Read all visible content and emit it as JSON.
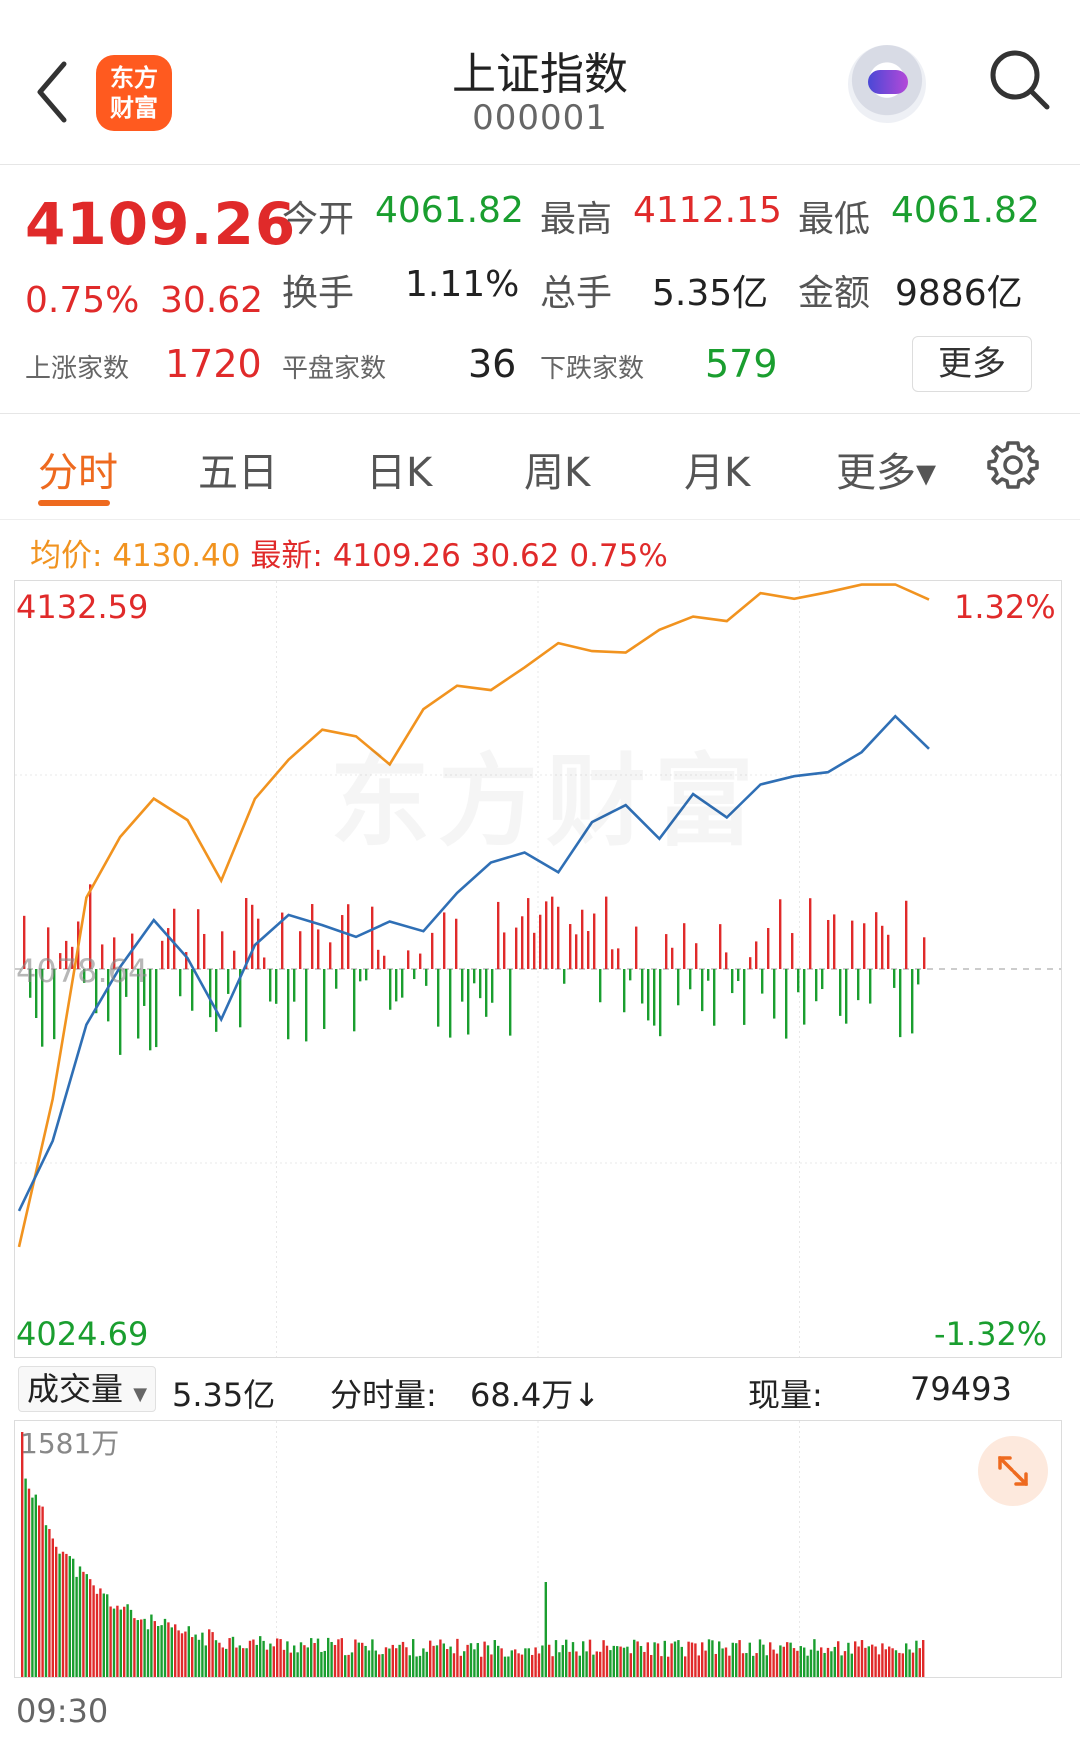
{
  "header": {
    "title": "上证指数",
    "code": "000001",
    "logo_text_line1": "东方",
    "logo_text_line2": "财富"
  },
  "quote": {
    "price": "4109.26",
    "change_pct": "0.75%",
    "change": "30.62",
    "open_label": "今开",
    "open": "4061.82",
    "high_label": "最高",
    "high": "4112.15",
    "low_label": "最低",
    "low": "4061.82",
    "turnover_label": "换手",
    "turnover": "1.11%",
    "volume_label": "总手",
    "volume": "5.35亿",
    "amount_label": "金额",
    "amount": "9886亿",
    "up_label": "上涨家数",
    "up_count": "1720",
    "flat_label": "平盘家数",
    "flat_count": "36",
    "down_label": "下跌家数",
    "down_count": "579",
    "more_label": "更多"
  },
  "tabs": [
    "分时",
    "五日",
    "日K",
    "周K",
    "月K",
    "更多▾"
  ],
  "info": {
    "avg_label": "均价:",
    "avg_value": "4130.40",
    "latest_label": "最新:",
    "latest_price": "4109.26",
    "latest_change": "30.62",
    "latest_pct": "0.75%"
  },
  "chart_labels": {
    "top_price": "4132.59",
    "top_pct": "1.32%",
    "bottom_price": "4024.69",
    "bottom_pct": "-1.32%",
    "mid_price": "4078.64",
    "watermark": "东方财富"
  },
  "volume_bar": {
    "select_label": "成交量",
    "total": "5.35亿",
    "period_label": "分时量:",
    "period_value": "68.4万↓",
    "current_label": "现量:",
    "current_value": "79493"
  },
  "volume_chart": {
    "max_label": "1581万",
    "time_start": "09:30"
  },
  "colors": {
    "red": "#e02a2a",
    "green": "#1a9e2f",
    "orange": "#f1931f",
    "blue": "#2f6fb5",
    "accent": "#ee6a1f"
  },
  "icons": {
    "back": "chevron-left-icon",
    "search": "search-icon",
    "settings": "gear-icon",
    "expand": "expand-icon"
  },
  "chart_data": {
    "type": "line",
    "x_range": [
      0,
      1
    ],
    "ylim": [
      4024.69,
      4132.59
    ],
    "prev_close": 4078.64,
    "series": [
      {
        "values": [
          4040,
          4060,
          4088,
          4096,
          4102,
          4099,
          4092,
          4103,
          4108,
          4112,
          4110,
          4107,
          4114,
          4118,
          4117,
          4120,
          4124,
          4123,
          4122,
          4126,
          4128,
          4127,
          4130,
          4129,
          4131,
          4132,
          4131,
          4130
        ]
      },
      {
        "values": [
          4045,
          4055,
          4070,
          4078,
          4085,
          4080,
          4072,
          4083,
          4087,
          4084,
          4082,
          4086,
          4085,
          4090,
          4094,
          4095,
          4093,
          4098,
          4101,
          4097,
          4102,
          4100,
          4104,
          4105,
          4107,
          4109,
          4113,
          4109.26
        ]
      }
    ]
  }
}
